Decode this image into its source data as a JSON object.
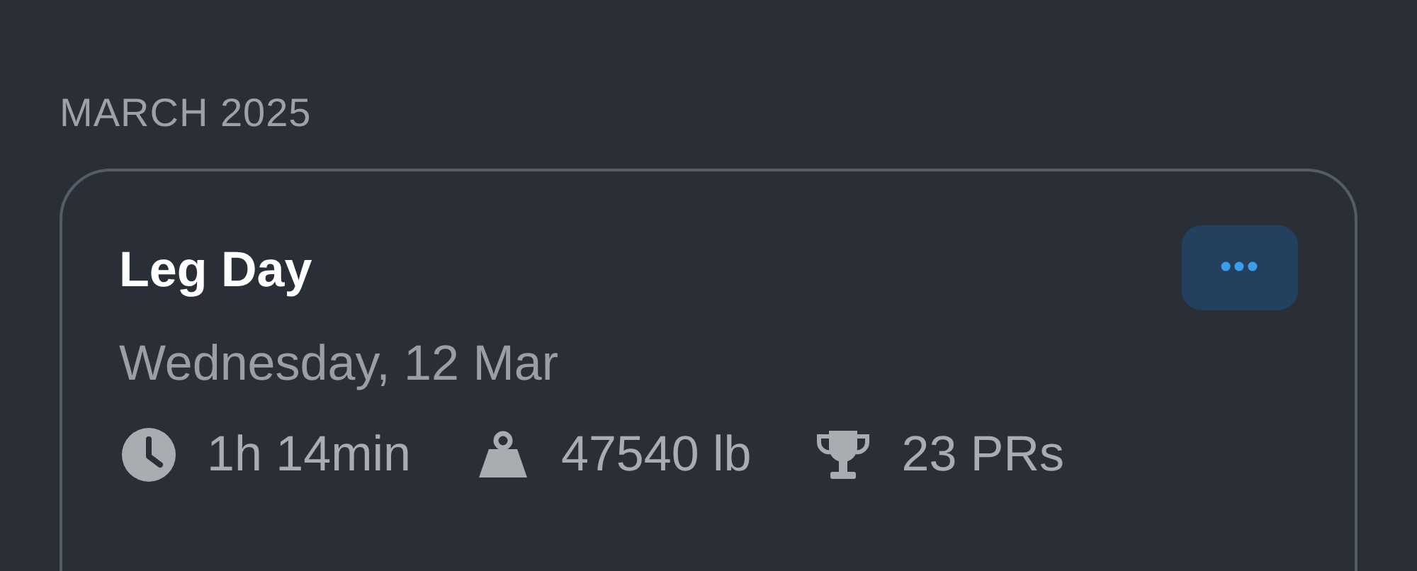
{
  "section": {
    "title": "MARCH 2025"
  },
  "workout": {
    "title": "Leg Day",
    "more_button": "•••",
    "date": "Wednesday, 12 Mar",
    "stats": [
      {
        "kind": "duration",
        "value": "1h 14min"
      },
      {
        "kind": "volume",
        "value": "47540 lb"
      },
      {
        "kind": "records",
        "value": "23 PRs"
      }
    ]
  }
}
